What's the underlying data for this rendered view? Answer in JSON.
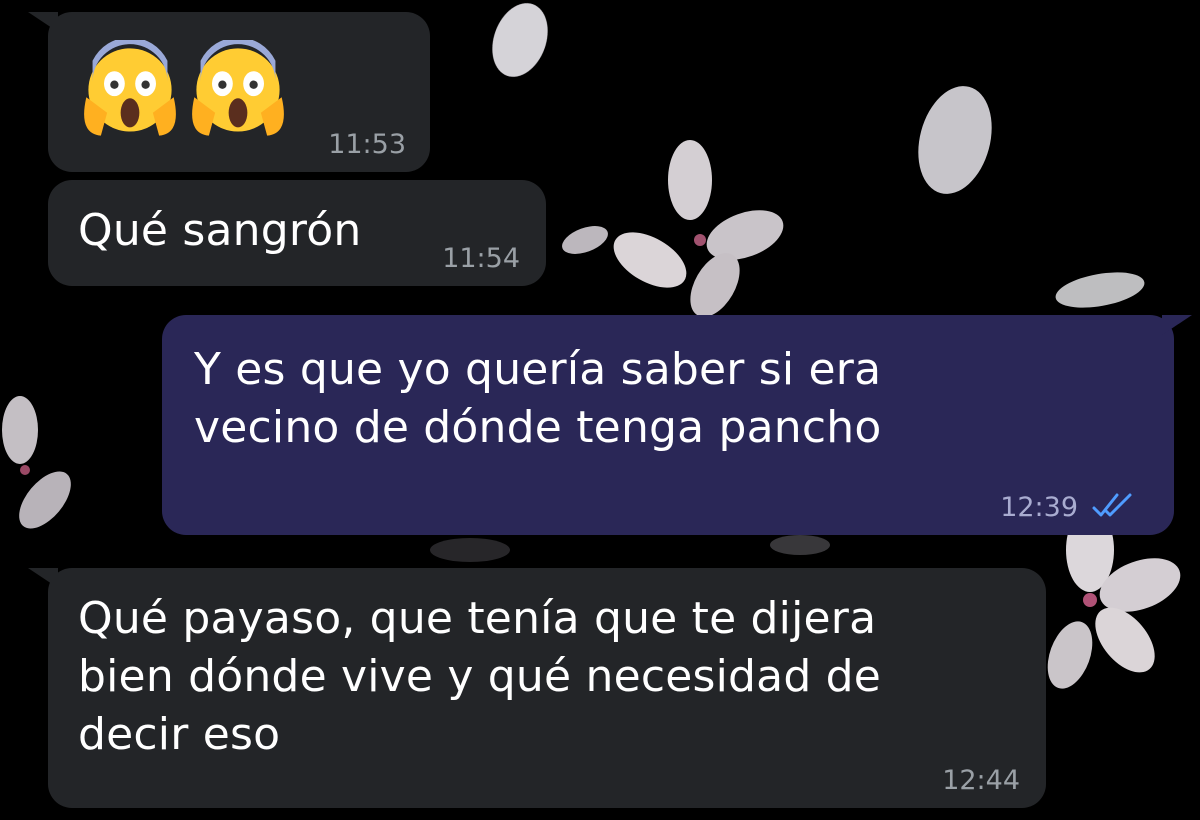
{
  "chat": {
    "messages": [
      {
        "direction": "incoming",
        "emoji": [
          "face-screaming-in-fear",
          "face-screaming-in-fear"
        ],
        "time": "11:53"
      },
      {
        "direction": "incoming",
        "text": "Qué sangrón",
        "time": "11:54"
      },
      {
        "direction": "outgoing",
        "text": "Y es que yo quería saber si era\nvecino de dónde tenga pancho",
        "time": "12:39",
        "status": "read",
        "status_icon": "double-check-icon"
      },
      {
        "direction": "incoming",
        "text": "Qué payaso, que tenía que te dijera\nbien dónde vive y qué necesidad de\ndecir eso",
        "time": "12:44"
      }
    ]
  },
  "colors": {
    "background": "#000000",
    "incoming_bubble": "#232528",
    "outgoing_bubble": "#2a2757",
    "read_ticks": "#4f9cff",
    "timestamp": "#9aa0a6"
  }
}
